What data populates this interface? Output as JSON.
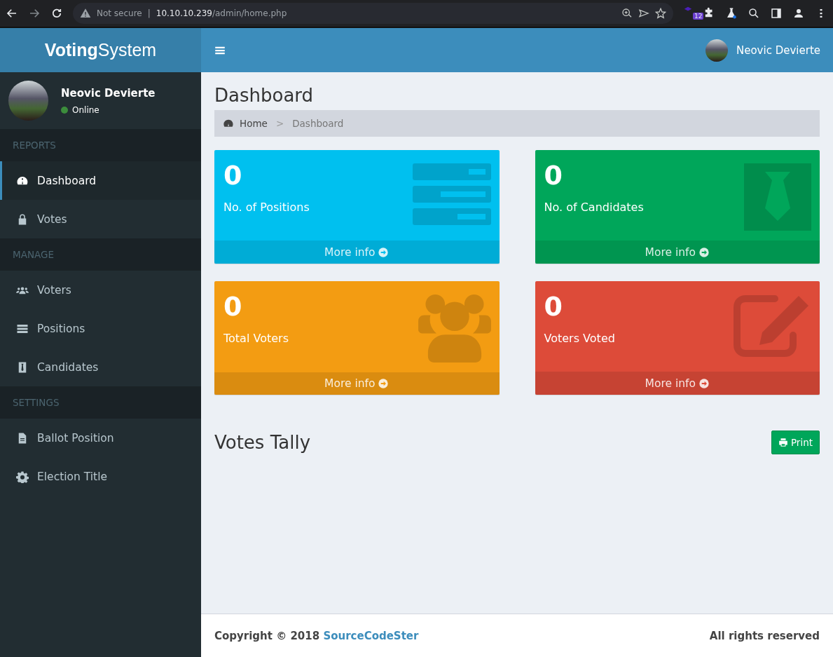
{
  "browser": {
    "security": "Not secure",
    "divider": "|",
    "url_host": "10.10.10.239",
    "url_path": "/admin/home.php",
    "extension_badge": "12"
  },
  "logo": {
    "bold": "Voting",
    "light": "System"
  },
  "user": {
    "name": "Neovic Devierte",
    "status": "Online"
  },
  "top_user": {
    "name": "Neovic Devierte"
  },
  "sidebar": {
    "sections": [
      {
        "header": "REPORTS",
        "items": [
          {
            "label": "Dashboard",
            "kind": "dashboard",
            "selected": true
          },
          {
            "label": "Votes",
            "kind": "lock",
            "selected": false
          }
        ]
      },
      {
        "header": "MANAGE",
        "items": [
          {
            "label": "Voters",
            "kind": "users",
            "selected": false
          },
          {
            "label": "Positions",
            "kind": "list",
            "selected": false
          },
          {
            "label": "Candidates",
            "kind": "tie",
            "selected": false
          }
        ]
      },
      {
        "header": "SETTINGS",
        "items": [
          {
            "label": "Ballot Position",
            "kind": "file",
            "selected": false
          },
          {
            "label": "Election Title",
            "kind": "gear",
            "selected": false
          }
        ]
      }
    ]
  },
  "page": {
    "title": "Dashboard",
    "breadcrumb": [
      "Home",
      "Dashboard"
    ],
    "separator": ">"
  },
  "cards": [
    {
      "value": "0",
      "label": "No. of Positions",
      "link": "More info",
      "kind": "positions",
      "color": "#00c0ef"
    },
    {
      "value": "0",
      "label": "No. of Candidates",
      "link": "More info",
      "kind": "candidates",
      "color": "#00a65a"
    },
    {
      "value": "0",
      "label": "Total Voters",
      "link": "More info",
      "kind": "voters",
      "color": "#f39c12"
    },
    {
      "value": "0",
      "label": "Voters Voted",
      "link": "More info",
      "kind": "voted",
      "color": "#dd4b39"
    }
  ],
  "tally": {
    "title": "Votes Tally",
    "print_button": "Print"
  },
  "footer": {
    "copyright": "Copyright © 2018",
    "link": "SourceCodeSter",
    "rights": "All rights reserved"
  }
}
